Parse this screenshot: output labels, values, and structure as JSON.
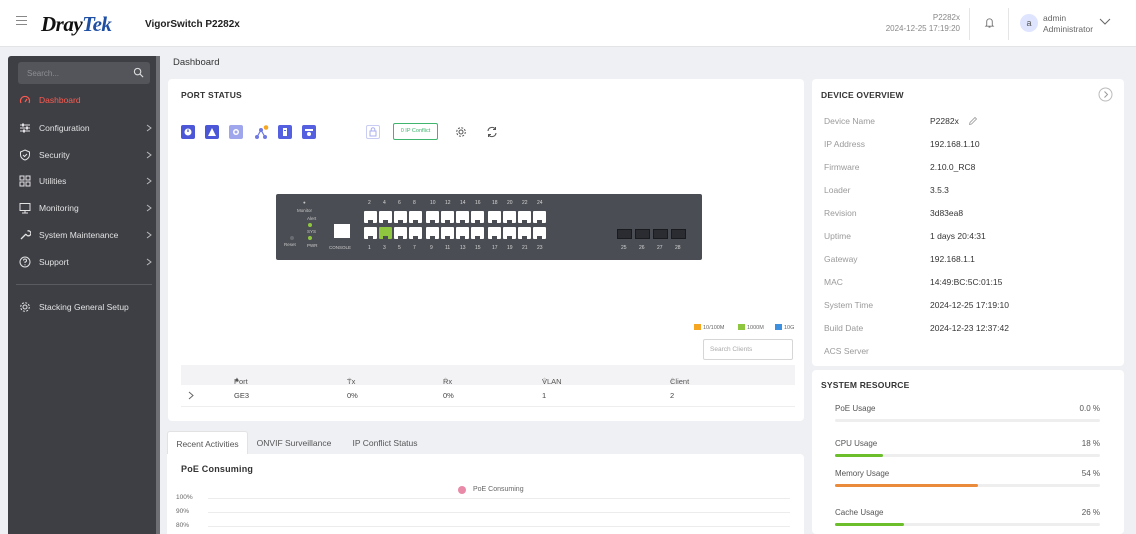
{
  "header": {
    "logo_part1": "Dray",
    "logo_part2": "Tek",
    "product": "VigorSwitch P2282x",
    "device_name": "P2282x",
    "device_time": "2024-12-25 17:19:20",
    "avatar_letter": "a",
    "user_name": "admin",
    "user_role": "Administrator"
  },
  "sidebar": {
    "search_placeholder": "Search...",
    "items": [
      {
        "label": "Dashboard",
        "icon": "dashboard-icon",
        "active": true
      },
      {
        "label": "Configuration",
        "icon": "sliders-icon"
      },
      {
        "label": "Security",
        "icon": "shield-icon"
      },
      {
        "label": "Utilities",
        "icon": "grid-icon"
      },
      {
        "label": "Monitoring",
        "icon": "monitor-icon"
      },
      {
        "label": "System Maintenance",
        "icon": "wrench-icon"
      },
      {
        "label": "Support",
        "icon": "help-icon"
      },
      {
        "label": "Stacking General Setup",
        "icon": "gear-icon"
      }
    ]
  },
  "breadcrumb": "Dashboard",
  "port_status": {
    "title": "PORT STATUS",
    "ip_conflict_label": "0 IP Conflict",
    "switch": {
      "top_ports": [
        "2",
        "4",
        "6",
        "8",
        "10",
        "12",
        "14",
        "16",
        "18",
        "20",
        "22",
        "24"
      ],
      "bottom_ports": [
        "1",
        "3",
        "5",
        "7",
        "9",
        "11",
        "13",
        "15",
        "17",
        "19",
        "21",
        "23"
      ],
      "sfp_ports": [
        "25",
        "26",
        "27",
        "28"
      ],
      "led_labels": [
        "Monitor",
        "Alert",
        "SYS",
        "PWR"
      ],
      "reset_label": "Reset",
      "console_label": "CONSOLE",
      "active_port": "3"
    },
    "legend": [
      {
        "label": "10/100M",
        "color": "#f5a623"
      },
      {
        "label": "1000M",
        "color": "#8fc63f"
      },
      {
        "label": "10G",
        "color": "#3d8fe0"
      }
    ],
    "search_placeholder": "Search Clients",
    "columns": [
      "Port",
      "Tx",
      "Rx",
      "VLAN",
      "Client"
    ],
    "rows": [
      {
        "port": "GE3",
        "tx": "0%",
        "rx": "0%",
        "vlan": "1",
        "client": "2"
      }
    ]
  },
  "tabs": [
    "Recent Activities",
    "ONVIF Surveillance",
    "IP Conflict Status"
  ],
  "poe_panel": {
    "title": "PoE Consuming",
    "legend": "PoE Consuming",
    "legend_color": "#e88aa8",
    "ticks": [
      "100%",
      "90%",
      "80%"
    ]
  },
  "device_overview": {
    "title": "DEVICE OVERVIEW",
    "rows": [
      {
        "label": "Device Name",
        "value": "P2282x"
      },
      {
        "label": "IP Address",
        "value": "192.168.1.10"
      },
      {
        "label": "Firmware",
        "value": "2.10.0_RC8"
      },
      {
        "label": "Loader",
        "value": "3.5.3"
      },
      {
        "label": "Revision",
        "value": "3d83ea8"
      },
      {
        "label": "Uptime",
        "value": "1 days 20:4:31"
      },
      {
        "label": "Gateway",
        "value": "192.168.1.1"
      },
      {
        "label": "MAC",
        "value": "14:49:BC:5C:01:15"
      },
      {
        "label": "System Time",
        "value": "2024-12-25 17:19:10"
      },
      {
        "label": "Build Date",
        "value": "2024-12-23 12:37:42"
      },
      {
        "label": "ACS Server",
        "value": ""
      }
    ]
  },
  "system_resource": {
    "title": "SYSTEM RESOURCE",
    "items": [
      {
        "label": "PoE Usage",
        "value": "0.0 %",
        "fraction": 0.0,
        "color": "#8fc63f"
      },
      {
        "label": "CPU Usage",
        "value": "18 %",
        "fraction": 0.18,
        "color": "#6cbf2a"
      },
      {
        "label": "Memory Usage",
        "value": "54 %",
        "fraction": 0.54,
        "color": "#e98b3a"
      },
      {
        "label": "Cache Usage",
        "value": "26 %",
        "fraction": 0.26,
        "color": "#6cbf2a"
      }
    ]
  }
}
